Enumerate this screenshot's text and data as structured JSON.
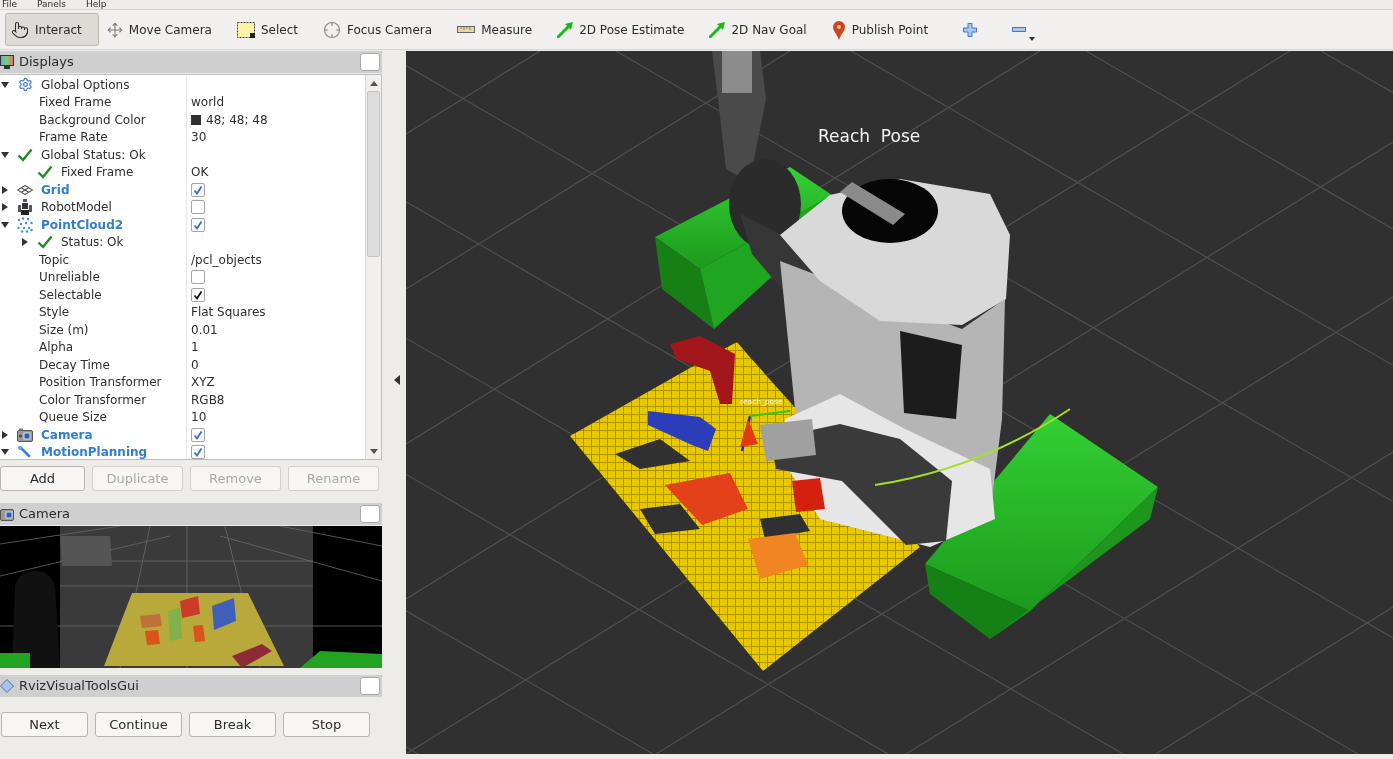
{
  "menu": [
    {
      "label": "File"
    },
    {
      "label": "Panels"
    },
    {
      "label": "Help"
    }
  ],
  "toolbar": [
    {
      "kind": "interact",
      "label": "Interact",
      "selected": true
    },
    {
      "kind": "move_camera",
      "label": "Move Camera",
      "selected": false
    },
    {
      "kind": "select",
      "label": "Select",
      "selected": false
    },
    {
      "kind": "focus_camera",
      "label": "Focus Camera",
      "selected": false
    },
    {
      "kind": "measure",
      "label": "Measure",
      "selected": false
    },
    {
      "kind": "pose_estimate",
      "label": "2D Pose Estimate",
      "selected": false
    },
    {
      "kind": "nav_goal",
      "label": "2D Nav Goal",
      "selected": false
    },
    {
      "kind": "publish_point",
      "label": "Publish Point",
      "selected": false
    },
    {
      "kind": "add_tool",
      "selected": false
    },
    {
      "kind": "remove_tool",
      "selected": false
    }
  ],
  "displays_panel": {
    "title": "Displays",
    "items": [
      {
        "kind": "global_options",
        "label": "Global Options",
        "expanded": true,
        "children": [
          {
            "kind": "property",
            "label": "Fixed Frame",
            "value": "world"
          },
          {
            "kind": "property",
            "label": "Background Color",
            "value": "48; 48; 48",
            "color": "#303030"
          },
          {
            "kind": "property",
            "label": "Frame Rate",
            "value": "30"
          }
        ]
      },
      {
        "kind": "global_status",
        "label": "Global Status: Ok",
        "expanded": true,
        "children": [
          {
            "kind": "status",
            "label": "Fixed Frame",
            "value": "OK"
          }
        ]
      },
      {
        "kind": "grid",
        "label": "Grid",
        "expanded": false,
        "checked": true
      },
      {
        "kind": "robot_model",
        "label": "RobotModel",
        "expanded": false,
        "checked": false
      },
      {
        "kind": "point_cloud",
        "label": "PointCloud2",
        "expanded": true,
        "checked": true,
        "children": [
          {
            "kind": "status",
            "label": "Status: Ok",
            "expanded": false
          },
          {
            "kind": "property",
            "label": "Topic",
            "value": "/pcl_objects"
          },
          {
            "kind": "property",
            "label": "Unreliable",
            "checked": false
          },
          {
            "kind": "property",
            "label": "Selectable",
            "checked": true
          },
          {
            "kind": "property",
            "label": "Style",
            "value": "Flat Squares"
          },
          {
            "kind": "property",
            "label": "Size (m)",
            "value": "0.01"
          },
          {
            "kind": "property",
            "label": "Alpha",
            "value": "1"
          },
          {
            "kind": "property",
            "label": "Decay Time",
            "value": "0"
          },
          {
            "kind": "property",
            "label": "Position Transformer",
            "value": "XYZ"
          },
          {
            "kind": "property",
            "label": "Color Transformer",
            "value": "RGB8"
          },
          {
            "kind": "property",
            "label": "Queue Size",
            "value": "10"
          }
        ]
      },
      {
        "kind": "camera",
        "label": "Camera",
        "expanded": false,
        "checked": true
      },
      {
        "kind": "motion_planning",
        "label": "MotionPlanning",
        "expanded": true,
        "checked": true
      }
    ],
    "buttons": [
      {
        "label": "Add",
        "disabled": false
      },
      {
        "label": "Duplicate",
        "disabled": true
      },
      {
        "label": "Remove",
        "disabled": true
      },
      {
        "label": "Rename",
        "disabled": true
      }
    ]
  },
  "camera_panel": {
    "title": "Camera"
  },
  "tools_panel": {
    "title": "RvizVisualToolsGui",
    "buttons": [
      {
        "label": "Next"
      },
      {
        "label": "Continue"
      },
      {
        "label": "Break"
      },
      {
        "label": "Stop"
      }
    ]
  },
  "viewport": {
    "labels": [
      {
        "kind": "title",
        "text": "Reach  Pose"
      },
      {
        "kind": "marker",
        "text": "reach_pose"
      }
    ]
  }
}
